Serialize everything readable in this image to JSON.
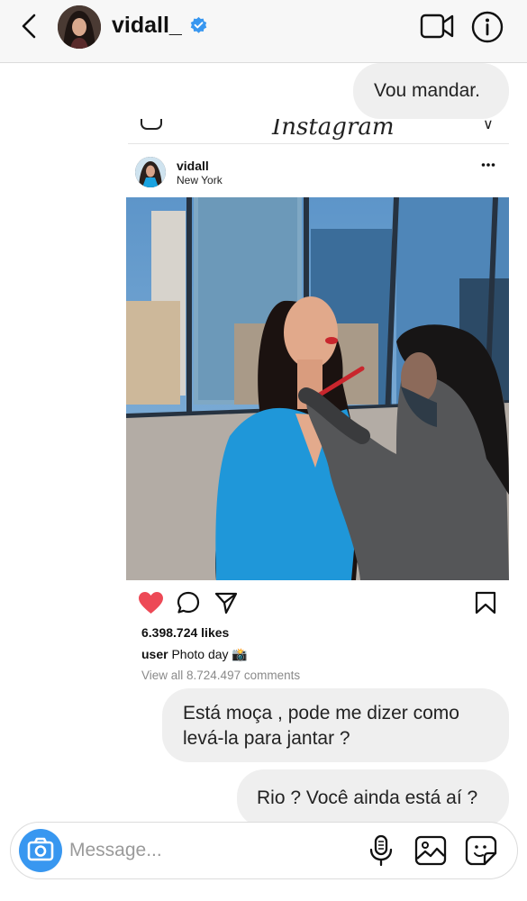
{
  "header": {
    "username": "vidall_",
    "verified": true,
    "icons": [
      "chevron-left-icon",
      "verified-badge-icon",
      "video-call-icon",
      "info-icon"
    ],
    "accent_color": "#3897f0"
  },
  "messages": [
    {
      "text": "Vou mandar.",
      "sent": true
    },
    {
      "text": "Está moça , pode me dizer como levá-la para jantar ?",
      "sent": true
    },
    {
      "text": "Rio ? Você ainda está aí ?",
      "sent": true
    }
  ],
  "shared_post": {
    "app_logo": "Instagram",
    "username": "vidall",
    "location": "New York",
    "liked": true,
    "likes": "6.398.724 likes",
    "caption_user": "user",
    "caption_text": " Photo day 📸",
    "comments_link": "View all 8.724.497 comments",
    "heart_color": "#ed4956"
  },
  "composer": {
    "placeholder": "Message...",
    "icons": [
      "camera-icon",
      "microphone-icon",
      "gallery-icon",
      "sticker-icon"
    ]
  }
}
